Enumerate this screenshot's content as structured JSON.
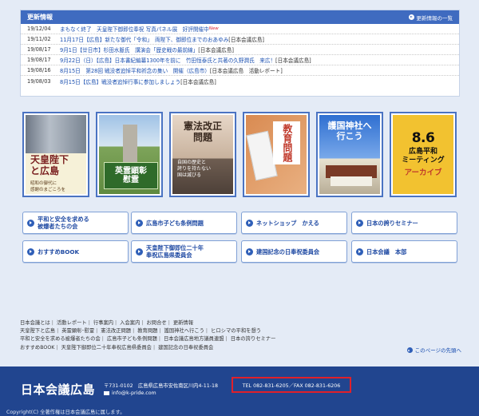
{
  "news": {
    "title": "更新情報",
    "more_label": "更新情報の一覧",
    "items": [
      {
        "date": "19/12/04",
        "link": "まもなく終了　天皇陛下御即位奉祝 写真パネル展　好評開催中",
        "rest": "",
        "badge": "New"
      },
      {
        "date": "19/11/02",
        "link": "11月17日【広島】新たな御代「令和」　両陛下、御即位までのおあゆみ",
        "rest": "[日本会議広島]",
        "badge": ""
      },
      {
        "date": "19/08/17",
        "link": "9月1日【廿日市】杉田水脈氏　講演会「歴史戦の最前線」",
        "rest": "[日本会議広島]",
        "badge": ""
      },
      {
        "date": "19/08/17",
        "link": "9月22日（日）【広島】日本書紀編纂1300年を前に　竹田恒泰氏と共著の久野潤氏　来広！",
        "rest": "[日本会議広島]",
        "badge": ""
      },
      {
        "date": "19/08/16",
        "link": "8月15日　第28回 戦没者追悼平和祈念の集い　開催（広島市）",
        "rest": "[日本会議広島　活動レポート]",
        "badge": ""
      },
      {
        "date": "19/08/03",
        "link": "8月15日【広島】戦没者追悼行事に参加しましょう",
        "rest": "[日本会議広島]",
        "badge": ""
      }
    ]
  },
  "banners": [
    {
      "name": "banner-tennou",
      "line1": "天皇陛下",
      "line2": "と広島",
      "sub": "昭和の御代に\n感謝のまごころを"
    },
    {
      "name": "banner-eirei",
      "line1": "英霊顕彰",
      "line2": "慰霊",
      "sub": ""
    },
    {
      "name": "banner-kenpou",
      "line1": "憲法改正",
      "line2": "問題",
      "sub": "自国の歴史と\n誇りを持たない\n国は滅びる"
    },
    {
      "name": "banner-kyouiku",
      "line1": "教育",
      "line2": "問題",
      "sub": ""
    },
    {
      "name": "banner-gokoku",
      "line1": "護国神社へ",
      "line2": "行こう",
      "sub": ""
    },
    {
      "name": "banner-86",
      "line1": "8.6",
      "line2": "広島平和\nミーティング",
      "sub": "アーカイブ"
    }
  ],
  "link_buttons": [
    {
      "label": "平和と安全を求める\n被爆者たちの会"
    },
    {
      "label": "広島市子ども条例問題"
    },
    {
      "label": "ネットショップ　かえる"
    },
    {
      "label": "日本の誇りセミナー"
    },
    {
      "label": "おすすめBOOK"
    },
    {
      "label": "天皇陛下御即位二十年\n奉祝広島県委員会"
    },
    {
      "label": "建国記念の日奉祝委員会"
    },
    {
      "label": "日本会議　本部"
    }
  ],
  "footer_links": {
    "row1": [
      "日本会議とは",
      "活動レポート",
      "行事案内",
      "入会案内",
      "お問合せ",
      "更新情報"
    ],
    "row2": [
      "天皇陛下と広島",
      "英霊顕彰･慰霊",
      "憲法改正問題",
      "教育問題",
      "護国神社へ行こう",
      "ヒロシマの平和を想う"
    ],
    "row3": [
      "平和と安全を求める被爆者たちの会",
      "広島市子ども条例問題",
      "日本会議広島地方議員連盟",
      "日本の誇りセミナー"
    ],
    "row4": [
      "おすすめBOOK",
      "天皇陛下御即位二十年奉祝広島県委員会",
      "建国記念の日奉祝委員会"
    ],
    "to_top": "このページの先頭へ"
  },
  "footer": {
    "logo": "日本会議広島",
    "address": "〒731-0102　広島県広島市安佐南区川内4-11-18",
    "tel": "TEL 082-831-6205／FAX 082-831-6206",
    "email": "info@k-pride.com",
    "copyright": "Copyright(C) 全著作権は日本会議広島に属します。"
  },
  "colors": {
    "accent": "#3f6bc0",
    "footer_bg": "#21458f",
    "highlight": "#e0202a"
  }
}
